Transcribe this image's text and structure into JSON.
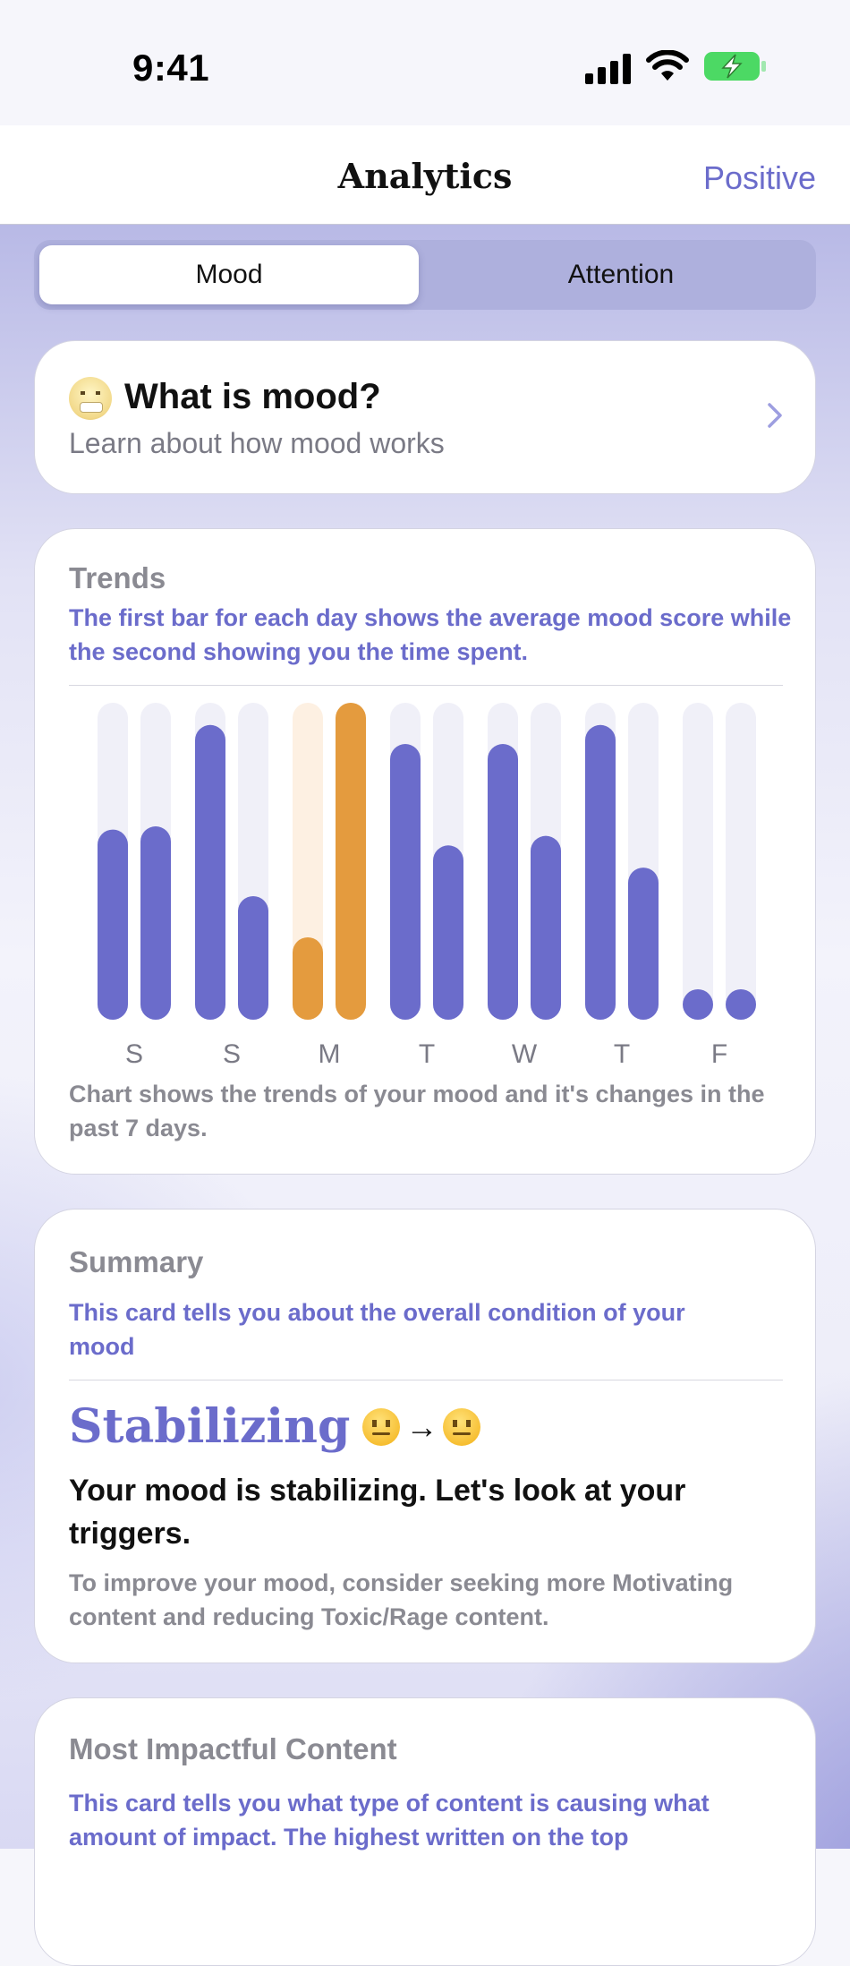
{
  "status_bar": {
    "time": "9:41"
  },
  "nav": {
    "title": "Analytics",
    "right_action": "Positive"
  },
  "segmented": {
    "options": [
      "Mood",
      "Attention"
    ],
    "selected": "Mood"
  },
  "mood_card": {
    "title": "What is mood?",
    "subtitle": "Learn about how mood works"
  },
  "trends_card": {
    "label": "Trends",
    "description": "The first bar for each day shows the average mood score while the second showing you the time spent.",
    "caption": "Chart shows the trends of your mood and it's changes in the past 7 days."
  },
  "chart_data": {
    "type": "bar",
    "categories": [
      "S",
      "S",
      "M",
      "T",
      "W",
      "T",
      "F"
    ],
    "series": [
      {
        "values": [
          0.6,
          0.93,
          0.26,
          0.87,
          0.87,
          0.93,
          0.0
        ]
      },
      {
        "values": [
          0.61,
          0.39,
          1.0,
          0.55,
          0.58,
          0.48,
          0.0
        ]
      }
    ],
    "ylim": [
      0,
      1
    ],
    "highlight_category_index": 2,
    "colors": {
      "normal": "#6b6ccb",
      "highlight": "#e49b3e",
      "track": "#f0f0f8",
      "highlight_track": "#fdf0e2"
    }
  },
  "summary_card": {
    "label": "Summary",
    "description": "This card tells you about the overall condition of your mood",
    "state": "Stabilizing",
    "headline": "Your mood is stabilizing. Let's look at your triggers.",
    "body": "To improve your mood, consider seeking more Motivating content and reducing Toxic/Rage content."
  },
  "impact_card": {
    "label": "Most Impactful Content",
    "description": "This card tells you what type of content is causing what amount of impact. The highest written on the top"
  }
}
